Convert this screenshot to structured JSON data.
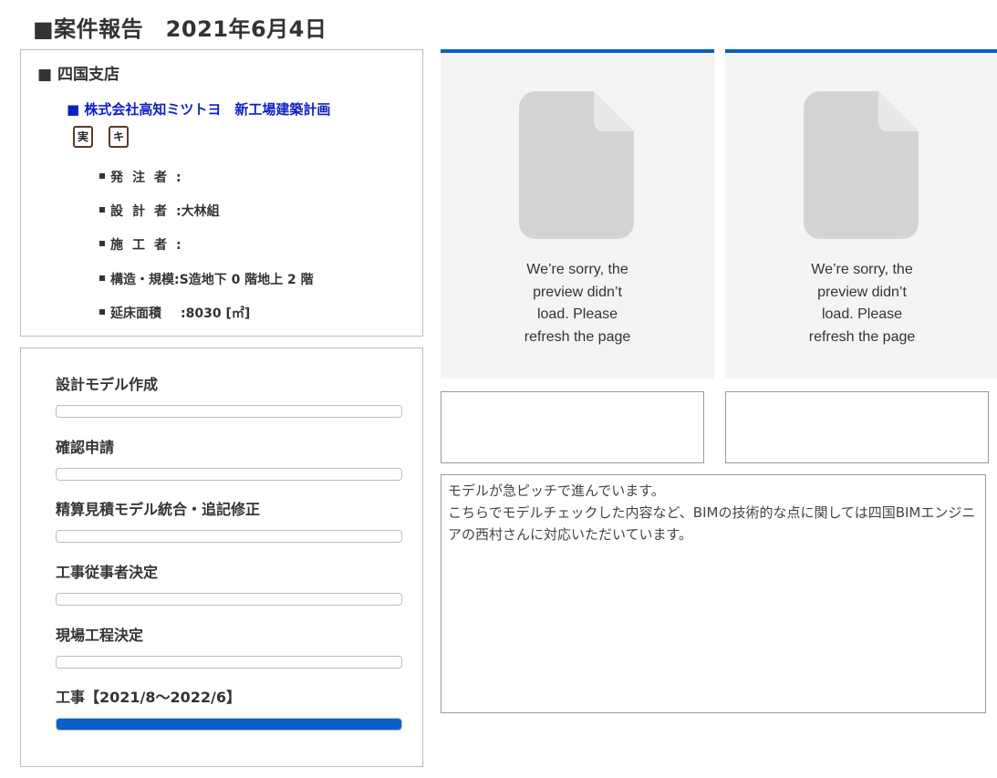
{
  "header": {
    "title": "■案件報告　2021年6月4日"
  },
  "branch": {
    "title": "■ 四国支店"
  },
  "project": {
    "title": "■ 株式会社高知ミツトヨ　新工場建築計画",
    "tags": [
      "実",
      "キ"
    ],
    "details": [
      {
        "label": "発注者",
        "value": ""
      },
      {
        "label": "設計者",
        "value": "大林組"
      },
      {
        "label": "施工者",
        "value": ""
      },
      {
        "label": "構造・規模",
        "value": "S造地下 0 階地上 2 階"
      },
      {
        "label": "延床面積",
        "value": "8030 [㎡]"
      }
    ]
  },
  "progress": {
    "steps": [
      {
        "label": "設計モデル作成",
        "progress": 0
      },
      {
        "label": "確認申請",
        "progress": 0
      },
      {
        "label": "精算見積モデル統合・追記修正",
        "progress": 0
      },
      {
        "label": "工事従事者決定",
        "progress": 0
      },
      {
        "label": "現場工程決定",
        "progress": 0
      },
      {
        "label": "工事【2021/8～2022/6】",
        "progress": 100
      }
    ]
  },
  "previews": [
    {
      "message": "We’re sorry, the preview didn’t load. Please refresh the page"
    },
    {
      "message": "We’re sorry, the preview didn’t load. Please refresh the page"
    }
  ],
  "captions": [
    "",
    ""
  ],
  "comment": {
    "text": "モデルが急ピッチで進んでいます。\nこちらでモデルチェックした内容など、BIMの技術的な点に関しては四国BIMエンジニアの西村さんに対応いただいています。"
  },
  "colors": {
    "accent": "#0a5fc9",
    "project_title": "#0d1fc7",
    "border": "#bdbdbd"
  }
}
